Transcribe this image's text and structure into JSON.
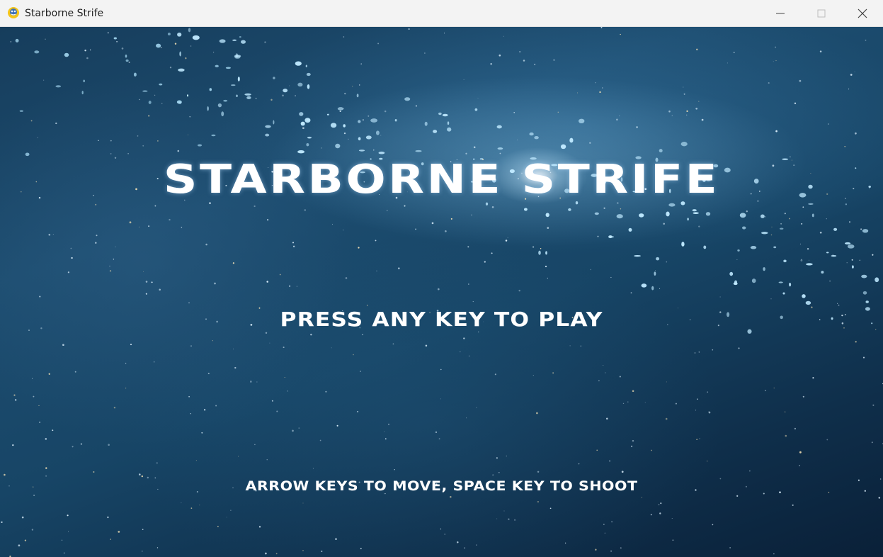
{
  "window": {
    "title": "Starborne Strife",
    "app_icon": "pygame-snake-icon",
    "controls": [
      "minimize-icon",
      "maximize-icon",
      "close-icon"
    ]
  },
  "game": {
    "title": "STARBORNE STRIFE",
    "prompt": "PRESS ANY KEY TO PLAY",
    "controls_hint": "ARROW KEYS TO MOVE, SPACE KEY TO SHOOT",
    "background": "space-nebula"
  },
  "colors": {
    "titlebar_bg": "#f3f3f3",
    "text": "#ffffff",
    "space_deep": "#0c2236",
    "space_mid": "#1d4d70"
  }
}
